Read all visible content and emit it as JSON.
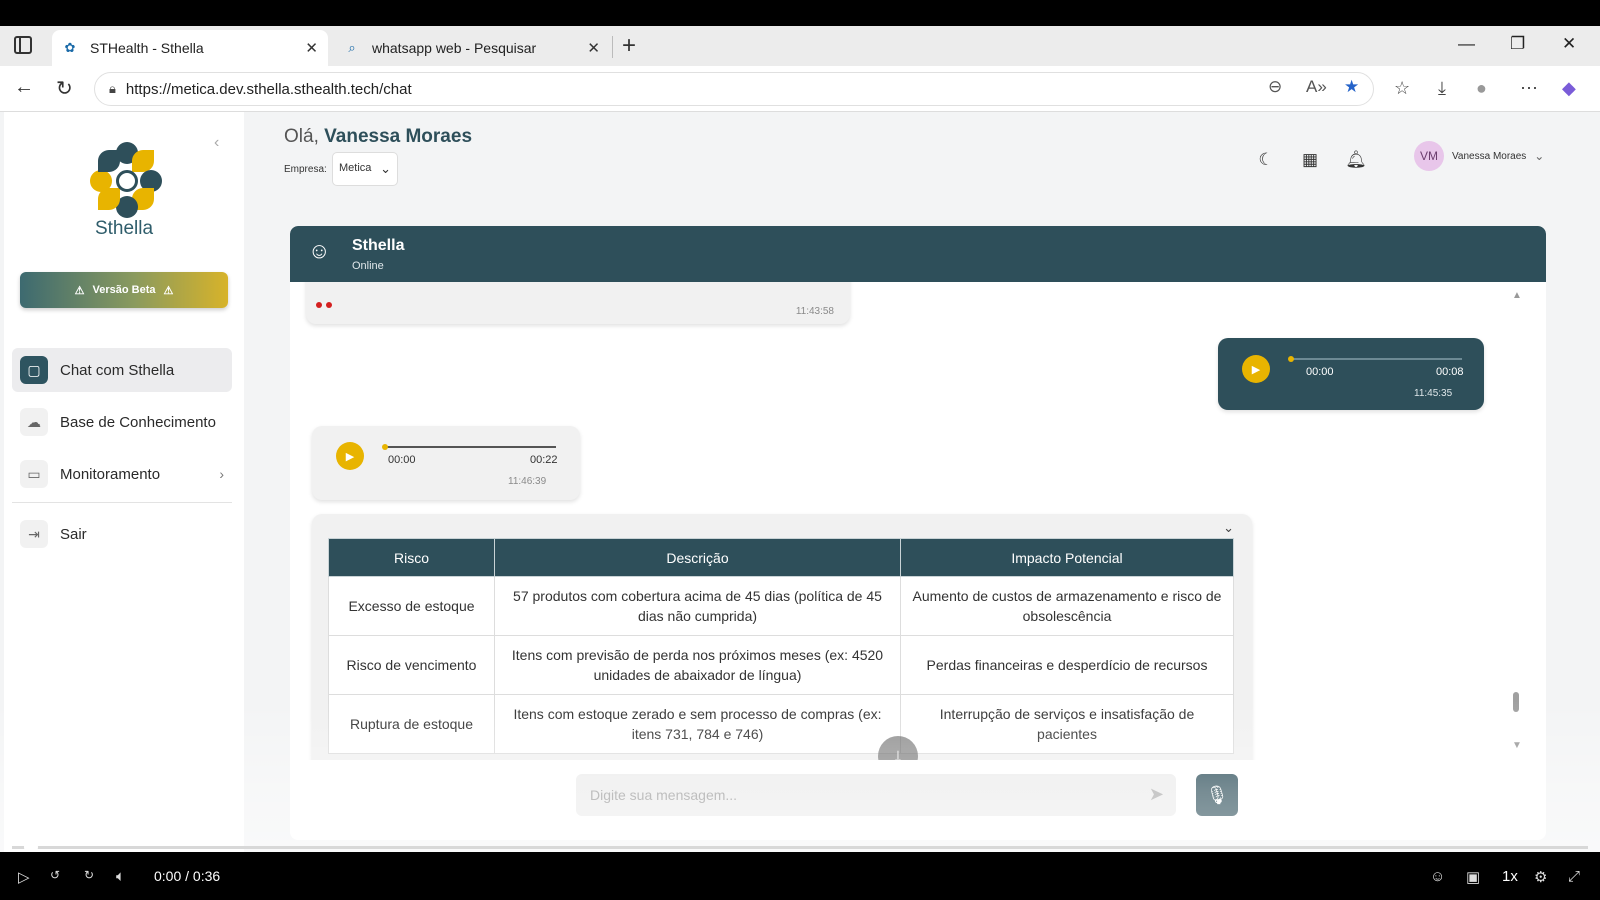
{
  "browser": {
    "tabs": [
      {
        "title": "STHealth - Sthella",
        "active": true
      },
      {
        "title": "whatsapp web - Pesquisar",
        "active": false
      }
    ],
    "url": "https://metica.dev.sthella.sthealth.tech/chat"
  },
  "sidebar": {
    "brand": "Sthella",
    "beta_label": "Versão Beta",
    "items": [
      {
        "label": "Chat com Sthella",
        "icon": "chat-icon",
        "active": true
      },
      {
        "label": "Base de Conhecimento",
        "icon": "cloud-upload-icon",
        "active": false
      },
      {
        "label": "Monitoramento",
        "icon": "monitor-icon",
        "active": false
      },
      {
        "label": "Sair",
        "icon": "logout-icon",
        "active": false
      }
    ]
  },
  "header": {
    "greeting": "Olá,",
    "user_name": "Vanessa Moraes",
    "company_label": "Empresa:",
    "company_value": "Metica",
    "avatar_initials": "VM"
  },
  "chat": {
    "agent_name": "Sthella",
    "status": "Online",
    "messages": [
      {
        "type": "table-fragment",
        "time": "11:43:58"
      },
      {
        "type": "audio",
        "direction": "out",
        "elapsed": "00:00",
        "duration": "00:08",
        "time": "11:45:35"
      },
      {
        "type": "audio",
        "direction": "in",
        "elapsed": "00:00",
        "duration": "00:22",
        "time": "11:46:39"
      }
    ],
    "table": {
      "headers": [
        "Risco",
        "Descrição",
        "Impacto Potencial"
      ],
      "rows": [
        [
          "Excesso de estoque",
          "57 produtos com cobertura acima de 45 dias (política de 45 dias não cumprida)",
          "Aumento de custos de armazenamento e risco de obsolescência"
        ],
        [
          "Risco de vencimento",
          "Itens com previsão de perda nos próximos meses (ex: 4520 unidades de abaixador de língua)",
          "Perdas financeiras e desperdício de recursos"
        ],
        [
          "Ruptura de estoque",
          "Itens com estoque zerado e sem processo de compras (ex: itens 731, 784 e 746)",
          "Interrupção de serviços e insatisfação de pacientes"
        ]
      ]
    },
    "input_placeholder": "Digite sua mensagem..."
  },
  "video": {
    "time": "0:00 / 0:36",
    "speed": "1x"
  }
}
